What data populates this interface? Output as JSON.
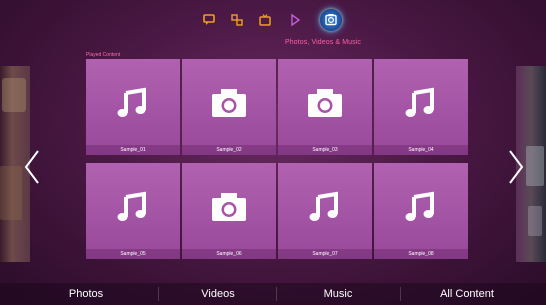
{
  "colors": {
    "accent": "#ff5fa2",
    "tile": "#a857a8",
    "background": "#4a1844",
    "active_mode": "#2a6cc8"
  },
  "header": {
    "modes": [
      {
        "name": "social",
        "icon": "speech-bubble-icon",
        "color": "#f0a020"
      },
      {
        "name": "apps",
        "icon": "apps-icon",
        "color": "#f0a020"
      },
      {
        "name": "tv",
        "icon": "tv-icon",
        "color": "#f0a020"
      },
      {
        "name": "video",
        "icon": "play-icon",
        "color": "#c060d8"
      },
      {
        "name": "photos-videos-music",
        "icon": "camera-icon",
        "active": true
      }
    ],
    "active_title": "Photos, Videos & Music"
  },
  "content": {
    "section_label": "Played Content",
    "items": [
      {
        "label": "Sample_01",
        "icon": "music-note-icon"
      },
      {
        "label": "Sample_02",
        "icon": "camera-icon"
      },
      {
        "label": "Sample_03",
        "icon": "camera-icon"
      },
      {
        "label": "Sample_04",
        "icon": "music-note-icon"
      },
      {
        "label": "Sample_05",
        "icon": "music-note-icon"
      },
      {
        "label": "Sample_06",
        "icon": "camera-icon"
      },
      {
        "label": "Sample_07",
        "icon": "music-note-icon"
      },
      {
        "label": "Sample_08",
        "icon": "music-note-icon"
      }
    ]
  },
  "navigation": {
    "left_arrow": "chevron-left-icon",
    "right_arrow": "chevron-right-icon"
  },
  "categories": [
    "Photos",
    "Videos",
    "Music",
    "All Content"
  ]
}
